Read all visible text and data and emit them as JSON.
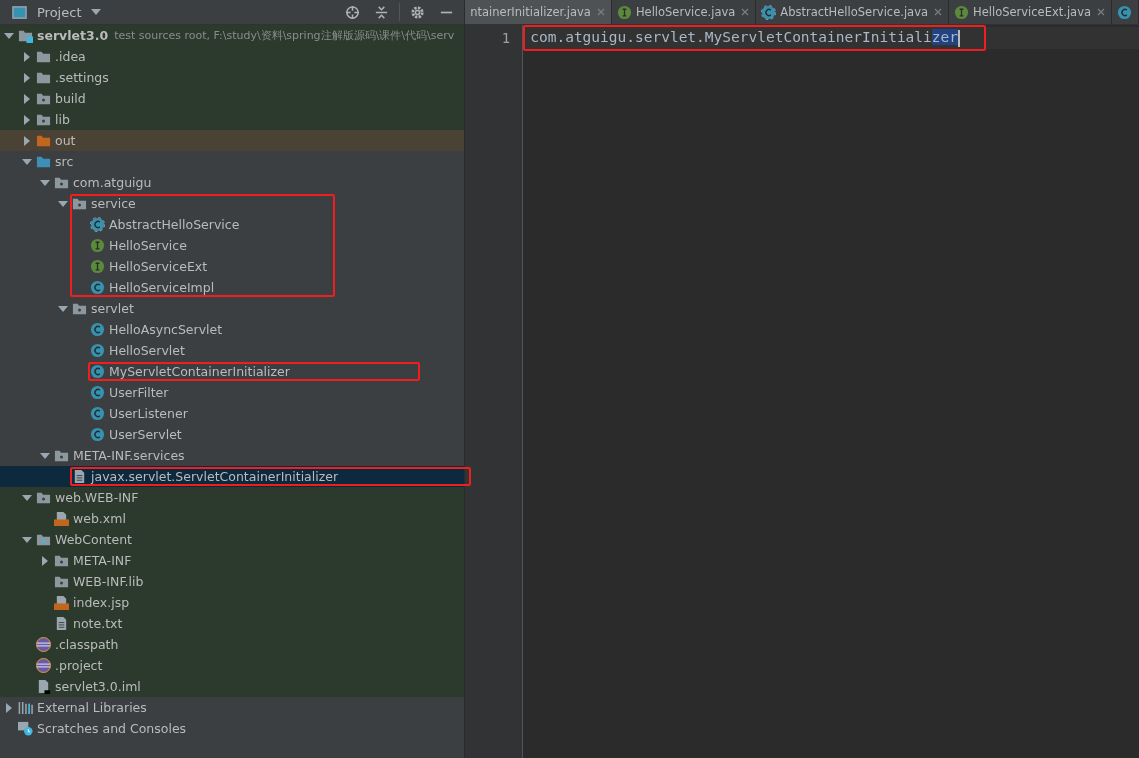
{
  "project_panel": {
    "title": "Project"
  },
  "tree": [
    {
      "label": "servlet3.0",
      "hint": "test sources root,  F:\\study\\资料\\spring注解版源码\\课件\\代码\\serv",
      "kind": "module",
      "expanded": true,
      "selected": false,
      "outlined": false,
      "children": [
        {
          "label": ".idea",
          "kind": "folder",
          "expanded": false,
          "selected": false,
          "outlined": false
        },
        {
          "label": ".settings",
          "kind": "folder",
          "expanded": false,
          "selected": false,
          "outlined": false
        },
        {
          "label": "build",
          "kind": "package",
          "expanded": false,
          "selected": false,
          "outlined": false
        },
        {
          "label": "lib",
          "kind": "package",
          "expanded": false,
          "selected": false,
          "outlined": false
        },
        {
          "label": "out",
          "kind": "excluded",
          "expanded": false,
          "selected": false,
          "outlined": false
        },
        {
          "label": "src",
          "kind": "source",
          "expanded": true,
          "selected": false,
          "outlined": false,
          "children": [
            {
              "label": "com.atguigu",
              "kind": "package",
              "expanded": true,
              "selected": false,
              "outlined": false,
              "children": [
                {
                  "label": "service",
                  "kind": "package",
                  "expanded": true,
                  "selected": false,
                  "outlined": true,
                  "children": [
                    {
                      "label": "AbstractHelloService",
                      "kind": "abstract",
                      "selected": false,
                      "outlined": true
                    },
                    {
                      "label": "HelloService",
                      "kind": "interface",
                      "selected": false,
                      "outlined": true
                    },
                    {
                      "label": "HelloServiceExt",
                      "kind": "interface",
                      "selected": false,
                      "outlined": true
                    },
                    {
                      "label": "HelloServiceImpl",
                      "kind": "class",
                      "selected": false,
                      "outlined": true
                    }
                  ]
                },
                {
                  "label": "servlet",
                  "kind": "package",
                  "expanded": true,
                  "selected": false,
                  "outlined": false,
                  "children": [
                    {
                      "label": "HelloAsyncServlet",
                      "kind": "class",
                      "selected": false,
                      "outlined": false
                    },
                    {
                      "label": "HelloServlet",
                      "kind": "class",
                      "selected": false,
                      "outlined": false
                    },
                    {
                      "label": "MyServletContainerInitializer",
                      "kind": "class",
                      "selected": false,
                      "outlined": true
                    },
                    {
                      "label": "UserFilter",
                      "kind": "class",
                      "selected": false,
                      "outlined": false
                    },
                    {
                      "label": "UserListener",
                      "kind": "class",
                      "selected": false,
                      "outlined": false
                    },
                    {
                      "label": "UserServlet",
                      "kind": "class",
                      "selected": false,
                      "outlined": false
                    }
                  ]
                }
              ]
            },
            {
              "label": "META-INF.services",
              "kind": "package",
              "expanded": true,
              "selected": false,
              "outlined": false,
              "children": [
                {
                  "label": "javax.servlet.ServletContainerInitializer",
                  "kind": "text",
                  "selected": true,
                  "outlined": true
                }
              ]
            }
          ]
        },
        {
          "label": "web.WEB-INF",
          "kind": "package",
          "expanded": true,
          "selected": false,
          "outlined": false,
          "children": [
            {
              "label": "web.xml",
              "kind": "xml",
              "selected": false,
              "outlined": false
            }
          ]
        },
        {
          "label": "WebContent",
          "kind": "web",
          "expanded": true,
          "selected": false,
          "outlined": false,
          "children": [
            {
              "label": "META-INF",
              "kind": "package",
              "expanded": false,
              "selected": false,
              "outlined": false
            },
            {
              "label": "WEB-INF.lib",
              "kind": "package",
              "selected": false,
              "outlined": false
            },
            {
              "label": "index.jsp",
              "kind": "jsp",
              "selected": false,
              "outlined": false
            },
            {
              "label": "note.txt",
              "kind": "text",
              "selected": false,
              "outlined": false
            }
          ]
        },
        {
          "label": ".classpath",
          "kind": "eclipse",
          "selected": false,
          "outlined": false
        },
        {
          "label": ".project",
          "kind": "eclipse",
          "selected": false,
          "outlined": false
        },
        {
          "label": "servlet3.0.iml",
          "kind": "iml",
          "selected": false,
          "outlined": false
        }
      ]
    },
    {
      "label": "External Libraries",
      "kind": "libraries",
      "expanded": false,
      "selected": false,
      "outlined": false
    },
    {
      "label": "Scratches and Consoles",
      "kind": "scratches",
      "selected": false,
      "outlined": false
    }
  ],
  "editor_tabs": [
    {
      "label": "ntainerInitializer.java",
      "kind": "none",
      "selected": true
    },
    {
      "label": "HelloService.java",
      "kind": "interface",
      "selected": false
    },
    {
      "label": "AbstractHelloService.java",
      "kind": "abstract",
      "selected": false
    },
    {
      "label": "HelloServiceExt.java",
      "kind": "interface",
      "selected": false
    },
    {
      "kind": "class",
      "selected": false
    }
  ],
  "editor": {
    "lines": [
      {
        "number": "1",
        "text": "com.atguigu.servlet.MyServletContainerInitiali",
        "selected_text": "zer",
        "outlined": true
      }
    ]
  }
}
